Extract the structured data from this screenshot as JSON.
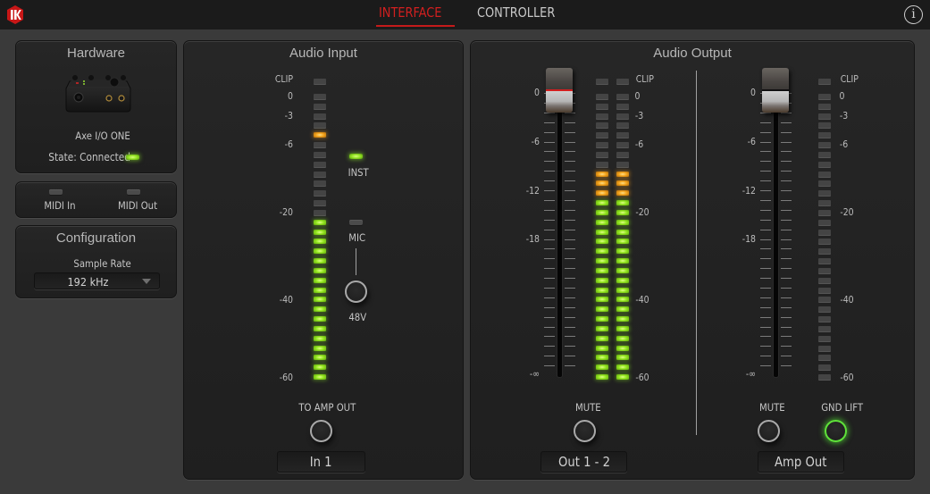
{
  "topbar": {
    "logo": "ik-logo-icon",
    "tabs": [
      {
        "label": "INTERFACE",
        "active": true
      },
      {
        "label": "CONTROLLER",
        "active": false
      }
    ],
    "info_icon": "info-icon",
    "info_glyph": "i"
  },
  "colors": {
    "accent_red": "#d21f1f",
    "led_green": "#8fe020",
    "led_orange": "#f5a51c",
    "gnd_lift_ring": "#5fe23a"
  },
  "hardware": {
    "title": "Hardware",
    "device_name": "Axe I/O ONE",
    "state_label": "State: Connected",
    "state_led_on": true
  },
  "midi": {
    "in_label": "MIDI In",
    "out_label": "MIDI Out",
    "in_led_on": false,
    "out_led_on": false
  },
  "configuration": {
    "title": "Configuration",
    "sample_rate_label": "Sample Rate",
    "sample_rate_value": "192 kHz"
  },
  "audio_input": {
    "title": "Audio Input",
    "meter_scale": [
      "CLIP",
      "0",
      "-3",
      "-6",
      "-20",
      "-40",
      "-60"
    ],
    "meter": {
      "segments": 30,
      "lit_segments": 17,
      "peak_hold_segment": 25,
      "clip": false
    },
    "inst_label": "INST",
    "inst_led_on": true,
    "mic_label": "MIC",
    "mic_led_on": false,
    "phantom_label": "48V",
    "phantom_on": false,
    "to_amp_out_label": "TO AMP OUT",
    "to_amp_out_on": false,
    "channel_name": "In 1"
  },
  "audio_output": {
    "title": "Audio Output",
    "channels": [
      {
        "id": "out12",
        "fader_scale": [
          "0",
          "-6",
          "-12",
          "-18",
          "-∞"
        ],
        "fader_value_db": 0,
        "meter_scale": [
          "CLIP",
          "0",
          "-3",
          "-6",
          "-20",
          "-40",
          "-60"
        ],
        "meters": [
          {
            "segments": 30,
            "lit_segments": 22,
            "orange_segments": 3,
            "clip": false
          },
          {
            "segments": 30,
            "lit_segments": 22,
            "orange_segments": 3,
            "clip": false
          }
        ],
        "mute_label": "MUTE",
        "mute_on": false,
        "name": "Out 1 - 2"
      },
      {
        "id": "ampout",
        "fader_scale": [
          "0",
          "-6",
          "-12",
          "-18",
          "-∞"
        ],
        "fader_value_db": 0,
        "meter_scale": [
          "CLIP",
          "0",
          "-3",
          "-6",
          "-20",
          "-40",
          "-60"
        ],
        "meters": [
          {
            "segments": 30,
            "lit_segments": 0,
            "orange_segments": 0,
            "clip": false
          }
        ],
        "mute_label": "MUTE",
        "mute_on": false,
        "gnd_lift_label": "GND LIFT",
        "gnd_lift_on": true,
        "name": "Amp Out"
      }
    ]
  }
}
